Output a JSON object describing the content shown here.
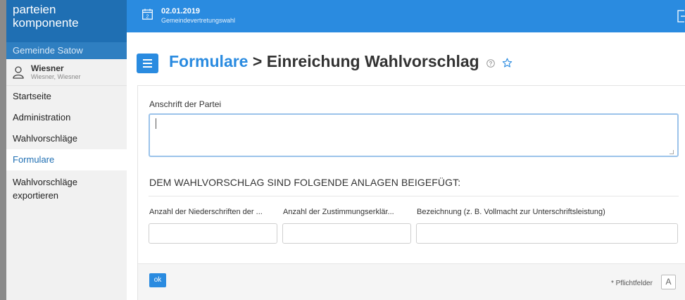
{
  "sidebar": {
    "brand_line1": "parteien",
    "brand_line2": "komponente",
    "org": "Gemeinde Satow",
    "user_name": "Wiesner",
    "user_sub": "Wiesner, Wiesner",
    "items": [
      {
        "label": "Startseite"
      },
      {
        "label": "Administration"
      },
      {
        "label": "Wahlvorschläge"
      },
      {
        "label": "Formulare"
      },
      {
        "label": "Wahlvorschläge exportieren"
      }
    ]
  },
  "topbar": {
    "date": "02.01.2019",
    "subtitle": "Gemeindevertretungswahl",
    "calendar_day": "2"
  },
  "header": {
    "crumb": "Formulare",
    "separator": " > ",
    "title": "Einreichung Wahlvorschlag"
  },
  "form": {
    "address_label": "Anschrift der Partei",
    "address_value": "",
    "section_heading": "DEM WAHLVORSCHLAG SIND FOLGENDE ANLAGEN BEIGEFÜGT:",
    "columns": [
      {
        "label": "Anzahl der Niederschriften der ...",
        "value": ""
      },
      {
        "label": "Anzahl der Zustimmungserklär...",
        "value": ""
      },
      {
        "label": "Bezeichnung (z. B. Vollmacht zur Unterschriftsleistung)",
        "value": ""
      }
    ]
  },
  "footer": {
    "ok_label": "ok",
    "required_note": "* Pflichtfelder",
    "font_toggle": "A"
  },
  "colors": {
    "brand": "#1f6fb3",
    "topbar": "#2a8be0",
    "accent": "#2a8be0",
    "focus_border": "#9cc3ea"
  }
}
